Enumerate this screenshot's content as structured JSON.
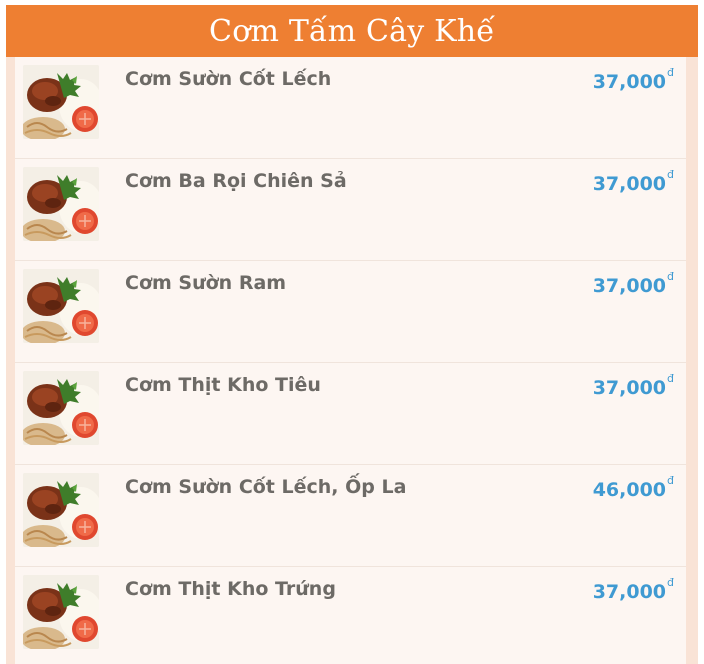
{
  "header": {
    "title": "Cơm Tấm Cây Khế"
  },
  "colors": {
    "header": "#ee7f32",
    "price": "#3f9ad2",
    "name": "#6d6a66"
  },
  "items": [
    {
      "name": "Cơm Sườn Cốt Lếch",
      "price": "37,000",
      "currency": "đ",
      "image": "dish-photo-icon"
    },
    {
      "name": "Cơm Ba Rọi Chiên Sả",
      "price": "37,000",
      "currency": "đ",
      "image": "dish-photo-icon"
    },
    {
      "name": "Cơm Sườn Ram",
      "price": "37,000",
      "currency": "đ",
      "image": "dish-photo-icon"
    },
    {
      "name": "Cơm Thịt Kho Tiêu",
      "price": "37,000",
      "currency": "đ",
      "image": "dish-photo-icon"
    },
    {
      "name": "Cơm Sườn Cốt Lếch, Ốp La",
      "price": "46,000",
      "currency": "đ",
      "image": "dish-photo-icon"
    },
    {
      "name": "Cơm Thịt Kho Trứng",
      "price": "37,000",
      "currency": "đ",
      "image": "dish-photo-icon"
    }
  ]
}
